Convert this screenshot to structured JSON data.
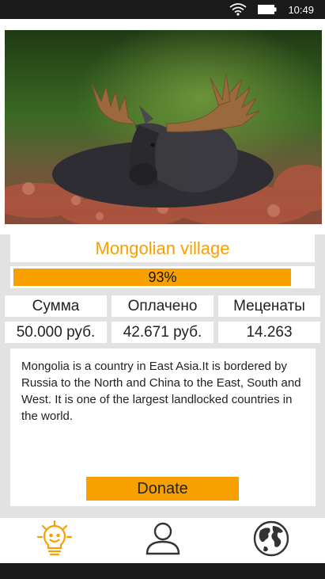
{
  "status_bar": {
    "time": "10:49",
    "icons": [
      "wifi-icon",
      "battery-icon"
    ]
  },
  "project": {
    "title": "Mongolian village",
    "progress_percent": 93,
    "progress_label": "93%",
    "image": "moose-photo"
  },
  "stats": {
    "headers": [
      "Сумма",
      "Оплачено",
      "Меценаты"
    ],
    "values": [
      "50.000 руб.",
      "42.671 руб.",
      "14.263"
    ]
  },
  "description": "Mongolia is a country in East Asia.It is bordered by Russia to the North and China to the East, South and West. It is one of the largest landlocked countries in the world.",
  "donate_label": "Donate",
  "nav": {
    "items": [
      "lightbulb-icon",
      "user-icon",
      "globe-icon"
    ],
    "active_index": 0
  },
  "colors": {
    "accent": "#f7a000",
    "background": "#e2e2e2",
    "inactive_icon": "#333333"
  }
}
